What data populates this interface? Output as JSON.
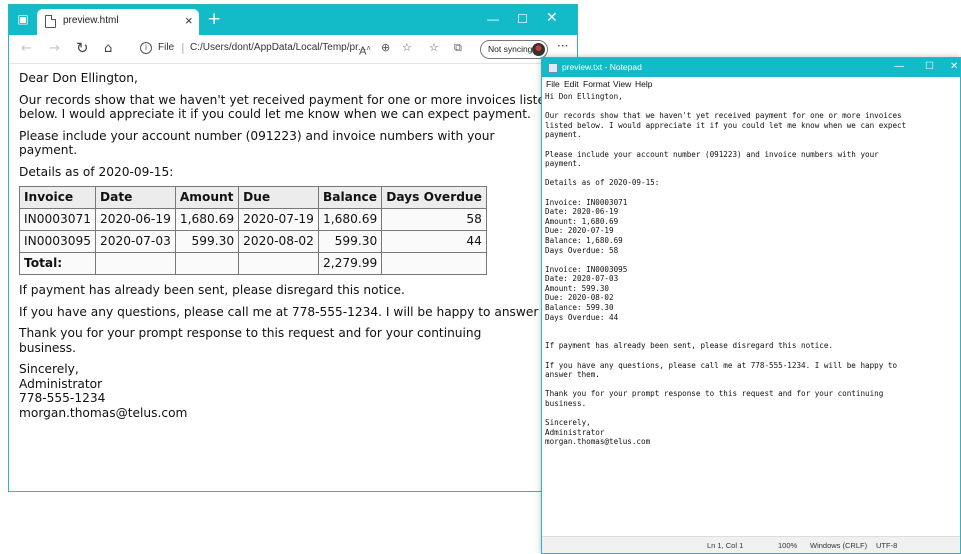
{
  "browser": {
    "tab_title": "preview.html",
    "address_label": "File",
    "address_url": "C:/Users/dont/AppData/Local/Temp/pr...",
    "sync_label": "Not syncing",
    "accent_color": "#13bac8"
  },
  "letter": {
    "greeting": "Dear Don Ellington,",
    "paragraph1": "Our records show that we haven't yet received payment for one or more invoices listed below. I would appreciate it if you could let me know when we can expect payment.",
    "paragraph2": "Please include your account number (091223) and invoice numbers with your payment.",
    "details_date": "Details as of 2020-09-15:",
    "table": {
      "headers": [
        "Invoice",
        "Date",
        "Amount",
        "Due",
        "Balance",
        "Days Overdue"
      ],
      "rows": [
        [
          "IN0003071",
          "2020-06-19",
          "1,680.69",
          "2020-07-19",
          "1,680.69",
          "58"
        ],
        [
          "IN0003095",
          "2020-07-03",
          "599.30",
          "2020-08-02",
          "599.30",
          "44"
        ]
      ],
      "total_label": "Total:",
      "total_balance": "2,279.99"
    },
    "paragraph3": "If payment has already been sent, please disregard this notice.",
    "paragraph4": "If you have any questions, please call me at 778-555-1234. I will be happy to answer them.",
    "paragraph5": "Thank you for your prompt response to this request and for your continuing business.",
    "closing": "Sincerely,",
    "sender_title": "Administrator",
    "sender_phone": "778-555-1234",
    "sender_email": "morgan.thomas@telus.com"
  },
  "notepad": {
    "title": "preview.txt - Notepad",
    "menu": [
      "File",
      "Edit",
      "Format",
      "View",
      "Help"
    ],
    "content": "Hi Don Ellington,\n\nOur records show that we haven't yet received payment for one or more invoices\nlisted below. I would appreciate it if you could let me know when we can expect\npayment.\n\nPlease include your account number (091223) and invoice numbers with your\npayment.\n\nDetails as of 2020-09-15:\n\nInvoice: IN0003071\nDate: 2020-06-19\nAmount: 1,680.69\nDue: 2020-07-19\nBalance: 1,680.69\nDays Overdue: 58\n\nInvoice: IN0003095\nDate: 2020-07-03\nAmount: 599.30\nDue: 2020-08-02\nBalance: 599.30\nDays Overdue: 44\n\n\nIf payment has already been sent, please disregard this notice.\n\nIf you have any questions, please call me at 778-555-1234. I will be happy to\nanswer them.\n\nThank you for your prompt response to this request and for your continuing\nbusiness.\n\nSincerely,\nAdministrator\nmorgan.thomas@telus.com",
    "status": {
      "position": "Ln 1, Col 1",
      "zoom": "100%",
      "line_ending": "Windows (CRLF)",
      "encoding": "UTF-8"
    }
  }
}
